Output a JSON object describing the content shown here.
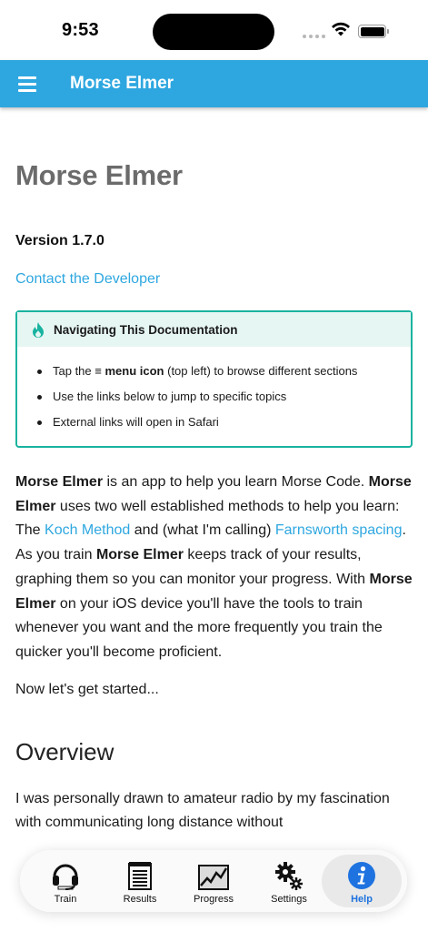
{
  "status_bar": {
    "time": "9:53"
  },
  "app_bar": {
    "title": "Morse Elmer"
  },
  "page": {
    "title": "Morse Elmer",
    "version": "Version 1.7.0",
    "contact_link": "Contact the Developer"
  },
  "nav_box": {
    "title": "Navigating This Documentation",
    "items": [
      {
        "pre": "Tap the ",
        "glyph": "≡",
        "bold": "menu icon",
        "post": " (top left) to browse different sections"
      },
      {
        "text": "Use the links below to jump to specific topics"
      },
      {
        "text": "External links will open in Safari"
      }
    ]
  },
  "intro": {
    "app_name": "Morse Elmer",
    "t1": " is an app to help you learn Morse Code. ",
    "t2": " uses two well established methods to help you learn: The ",
    "koch_link": "Koch Method",
    "t3": " and (what I'm calling) ",
    "farnsworth_link": "Farnsworth spacing",
    "t4": ". As you train ",
    "t5": " keeps track of your results, graphing them so you can monitor your progress. With ",
    "t6": " on your iOS device you'll have the tools to train whenever you want and the more frequently you train the quicker you'll become proficient."
  },
  "started": "Now let's get started...",
  "overview": {
    "heading": "Overview",
    "text": "I was personally drawn to amateur radio by my fascination with communicating long distance without"
  },
  "tabs": [
    {
      "label": "Train",
      "icon": "headset-icon"
    },
    {
      "label": "Results",
      "icon": "notepad-icon"
    },
    {
      "label": "Progress",
      "icon": "chart-icon"
    },
    {
      "label": "Settings",
      "icon": "gears-icon"
    },
    {
      "label": "Help",
      "icon": "info-icon",
      "active": true
    }
  ],
  "colors": {
    "accent": "#2ea7e0",
    "note_border": "#19b3a0",
    "note_bg": "#e6f6f3",
    "active_tab": "#1e73e0"
  }
}
